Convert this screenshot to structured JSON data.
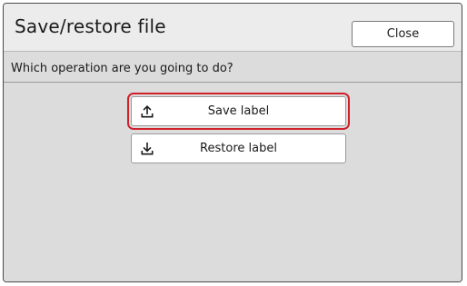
{
  "dialog": {
    "title": "Save/restore file",
    "close_label": "Close"
  },
  "main": {
    "prompt": "Which operation are you going to do?",
    "buttons": [
      {
        "label": "Save label",
        "icon": "upload-icon",
        "highlighted": true
      },
      {
        "label": "Restore label",
        "icon": "download-icon",
        "highlighted": false
      }
    ]
  },
  "colors": {
    "highlight": "#d0202a",
    "body_background": "#dcdcdc",
    "header_background": "#ececec"
  }
}
